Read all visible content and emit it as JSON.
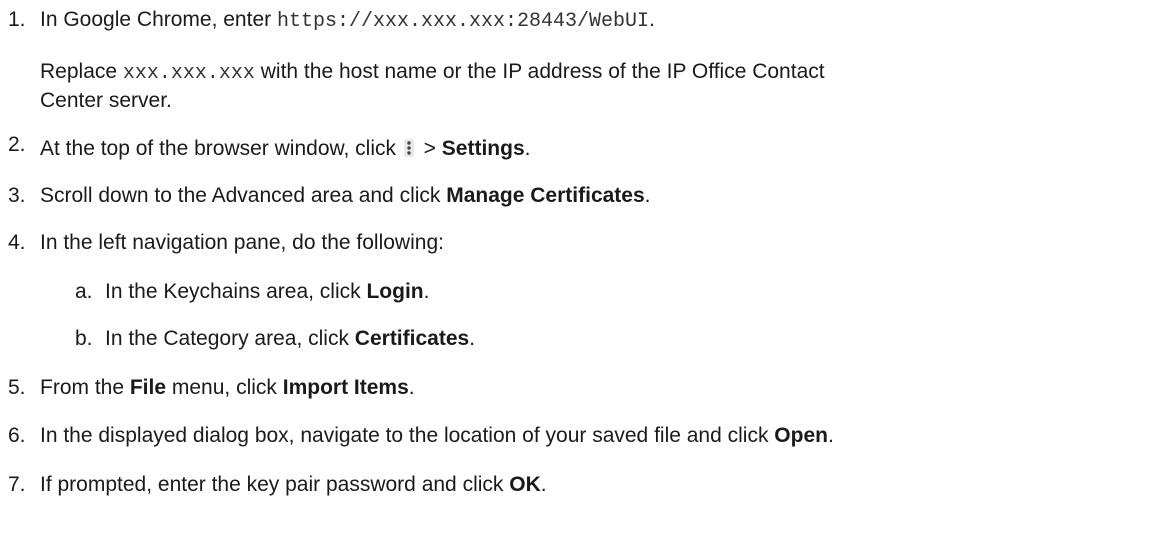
{
  "steps": [
    {
      "number": "1.",
      "prefix": "In Google Chrome, enter ",
      "url": "https://xxx.xxx.xxx:28443/WebUI",
      "suffix": ".",
      "note": {
        "prefix": "Replace ",
        "code": "xxx.xxx.xxx",
        "line1_rest": " with the host name or the IP address of the IP Office Contact",
        "line2": "Center server."
      }
    },
    {
      "number": "2.",
      "prefix": "At the top of the browser window, click ",
      "icon": "kebab-menu-icon",
      "separator": " > ",
      "bold": "Settings",
      "suffix": "."
    },
    {
      "number": "3.",
      "prefix": "Scroll down to the Advanced area and click ",
      "bold": "Manage Certificates",
      "suffix": "."
    },
    {
      "number": "4.",
      "text": "In the left navigation pane, do the following:",
      "substeps": [
        {
          "letter": "a.",
          "prefix": "In the Keychains area, click ",
          "bold": "Login",
          "suffix": "."
        },
        {
          "letter": "b.",
          "prefix": "In the Category area, click ",
          "bold": "Certificates",
          "suffix": "."
        }
      ]
    },
    {
      "number": "5.",
      "prefix": "From the ",
      "bold1": "File",
      "middle": " menu, click ",
      "bold2": "Import Items",
      "suffix": "."
    },
    {
      "number": "6.",
      "prefix": "In the displayed dialog box, navigate to the location of your saved file and click ",
      "bold": "Open",
      "suffix": "."
    },
    {
      "number": "7.",
      "prefix": "If prompted, enter the key pair password and click ",
      "bold": "OK",
      "suffix": "."
    }
  ]
}
